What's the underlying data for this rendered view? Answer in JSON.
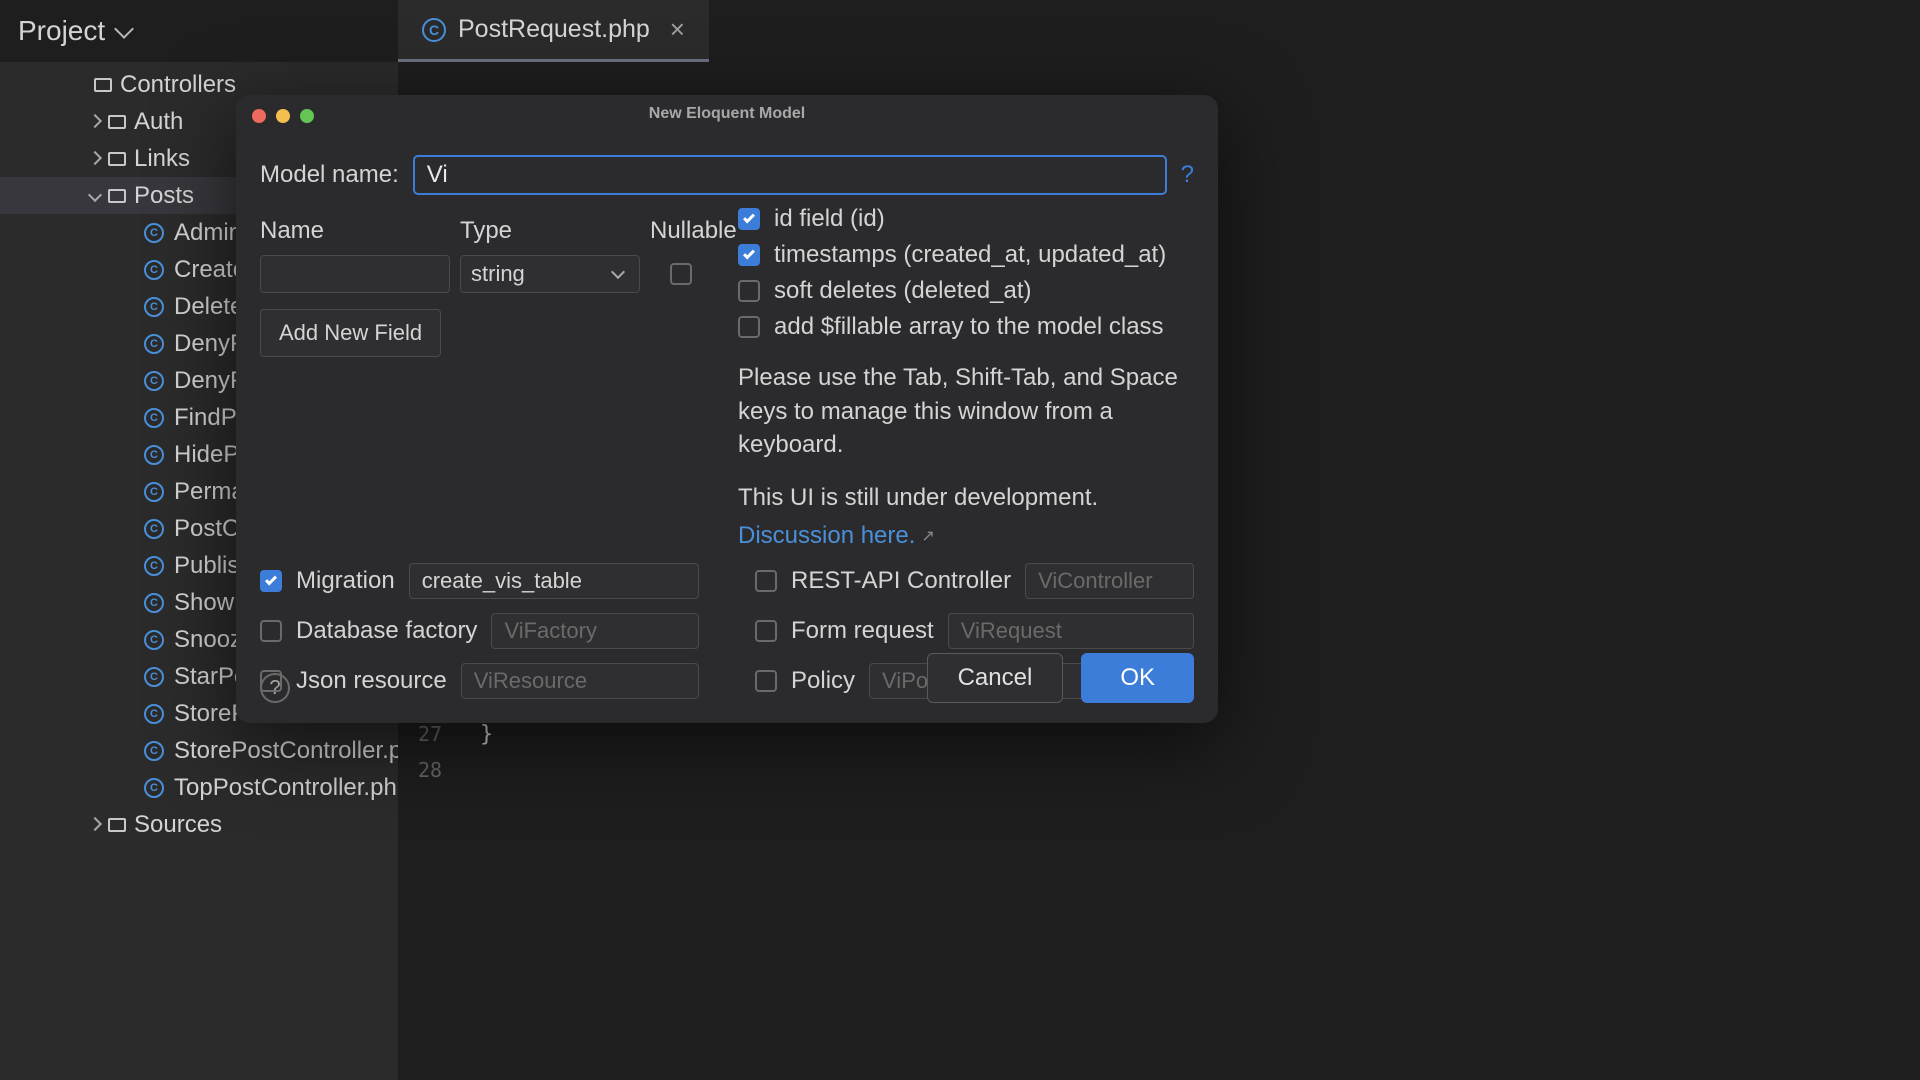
{
  "project_label": "Project",
  "tab": {
    "name": "PostRequest.php"
  },
  "tree": {
    "controllers": "Controllers",
    "auth": "Auth",
    "links": "Links",
    "posts": "Posts",
    "sources": "Sources",
    "post_items": [
      "Admin",
      "Create",
      "Delete",
      "DenyP",
      "DenyP",
      "FindPo",
      "HidePo",
      "Perma",
      "PostCo",
      "Publisl",
      "ShowP",
      "Snooz",
      "StarPo",
      "StoreP",
      "StorePostController.p",
      "TopPostController.php"
    ]
  },
  "gutter": {
    "n1": "27",
    "n2": "28"
  },
  "dialog": {
    "title": "New Eloquent Model",
    "model_name_label": "Model name:",
    "model_name_value": "Vi",
    "fields_header": {
      "name": "Name",
      "type": "Type",
      "nullable": "Nullable"
    },
    "field_type_value": "string",
    "add_field": "Add New Field",
    "options": {
      "id": "id field (id)",
      "timestamps": "timestamps (created_at, updated_at)",
      "soft_deletes": "soft deletes (deleted_at)",
      "fillable": "add $fillable array to the model class"
    },
    "hint": "Please use the Tab, Shift-Tab, and Space keys to manage this window from a keyboard.",
    "dev_notice": "This UI is still under development.",
    "discussion_link": "Discussion here.",
    "bottom": {
      "migration": "Migration",
      "migration_value": "create_vis_table",
      "factory": "Database factory",
      "factory_ph": "ViFactory",
      "json": "Json resource",
      "json_ph": "ViResource",
      "rest": "REST-API Controller",
      "rest_ph": "ViController",
      "form": "Form request",
      "form_ph": "ViRequest",
      "policy": "Policy",
      "policy_ph": "ViPolicy"
    },
    "cancel": "Cancel",
    "ok": "OK"
  }
}
